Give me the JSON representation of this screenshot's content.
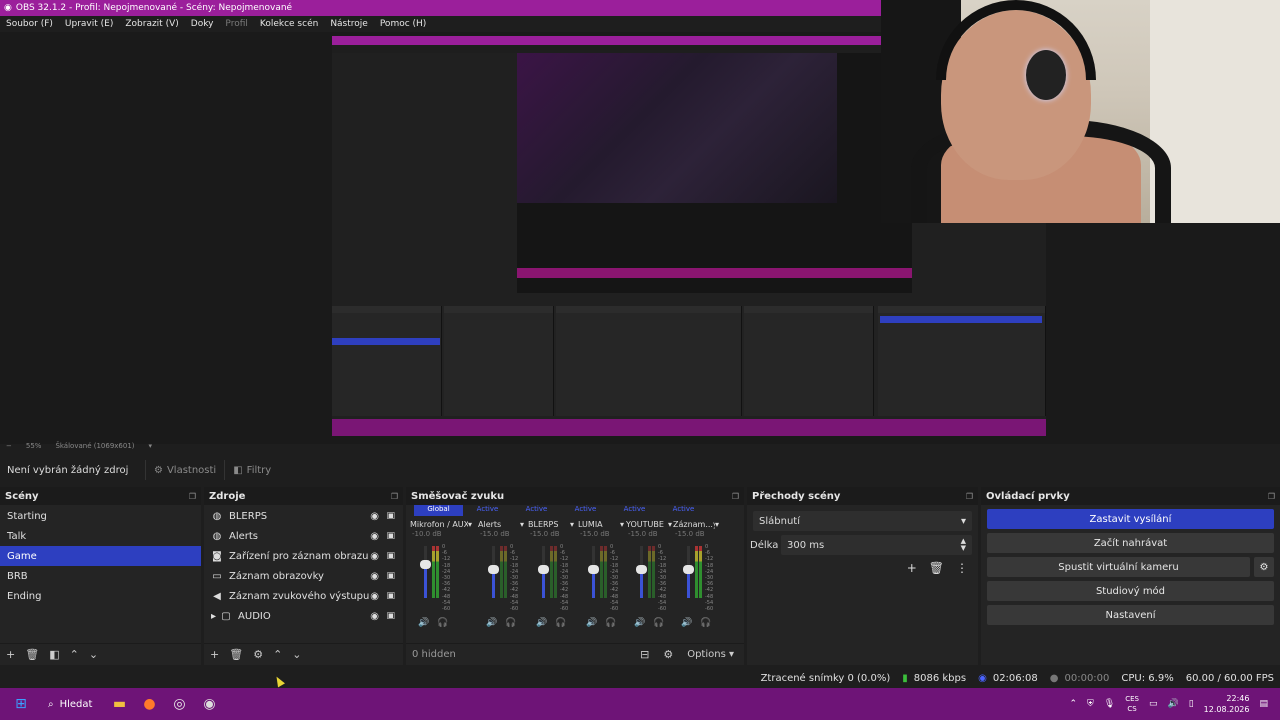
{
  "window": {
    "title": "OBS 32.1.2 - Profil: Nepojmenované - Scény: Nepojmenované"
  },
  "menu": [
    {
      "label": "Soubor (F)",
      "dim": false
    },
    {
      "label": "Upravit (E)",
      "dim": false
    },
    {
      "label": "Zobrazit (V)",
      "dim": false
    },
    {
      "label": "Doky",
      "dim": false
    },
    {
      "label": "Profil",
      "dim": true
    },
    {
      "label": "Kolekce scén",
      "dim": false
    },
    {
      "label": "Nástroje",
      "dim": false
    },
    {
      "label": "Pomoc (H)",
      "dim": false
    }
  ],
  "preview": {
    "zoom": "55%",
    "scale_mode": "Škálované (1069x601)"
  },
  "context": {
    "no_source": "Není vybrán žádný zdroj",
    "properties": "Vlastnosti",
    "filters": "Filtry"
  },
  "scenes": {
    "title": "Scény",
    "items": [
      "Starting",
      "Talk",
      "Game",
      "BRB",
      "Ending"
    ],
    "selected_index": 2
  },
  "sources": {
    "title": "Zdroje",
    "items": [
      {
        "label": "BLERPS",
        "icon": "globe-icon"
      },
      {
        "label": "Alerts",
        "icon": "globe-icon"
      },
      {
        "label": "Zařízení pro záznam obrazu",
        "icon": "camera-icon"
      },
      {
        "label": "Záznam obrazovky",
        "icon": "monitor-icon"
      },
      {
        "label": "Záznam zvukového výstupu",
        "icon": "speaker-icon"
      },
      {
        "label": "AUDIO",
        "icon": "folder-icon"
      }
    ]
  },
  "mixer": {
    "title": "Směšovač zvuku",
    "tabs": [
      "Global",
      "Active",
      "Active",
      "Active",
      "Active",
      "Active"
    ],
    "channels": [
      {
        "name": "Mikrofon / AUX",
        "db": "-10.0 dB",
        "level": 0.65,
        "hot": true
      },
      {
        "name": "Alerts",
        "db": "-15.0 dB",
        "level": 0.55,
        "hot": false
      },
      {
        "name": "BLERPS",
        "db": "-15.0 dB",
        "level": 0.55,
        "hot": false
      },
      {
        "name": "LUMIA",
        "db": "-15.0 dB",
        "level": 0.55,
        "hot": false
      },
      {
        "name": "YOUTUBE",
        "db": "-15.0 dB",
        "level": 0.55,
        "hot": false
      },
      {
        "name": "Záznam...ýstupu",
        "db": "-15.0 dB",
        "level": 0.55,
        "hot": true
      }
    ],
    "scale": [
      "0",
      "-6",
      "-12",
      "-18",
      "-24",
      "-30",
      "-36",
      "-42",
      "-48",
      "-54",
      "-60"
    ],
    "hidden": "0 hidden",
    "options": "Options"
  },
  "transitions": {
    "title": "Přechody scény",
    "selected": "Slábnutí",
    "duration_label": "Délka",
    "duration": "300 ms"
  },
  "controls": {
    "title": "Ovládací prvky",
    "stop_stream": "Zastavit vysílání",
    "start_record": "Začít nahrávat",
    "virtual_cam": "Spustit virtuální kameru",
    "studio_mode": "Studiový mód",
    "settings": "Nastavení"
  },
  "status": {
    "dropped": "Ztracené snímky 0 (0.0%)",
    "bitrate": "8086 kbps",
    "stream_time": "02:06:08",
    "record_time": "00:00:00",
    "cpu": "CPU: 6.9%",
    "fps": "60.00 / 60.00 FPS"
  },
  "taskbar": {
    "search": "Hledat",
    "lang_top": "CES",
    "lang_bottom": "CS",
    "time": "22:46",
    "date": "12.08.2026"
  },
  "colors": {
    "accent": "#2d3fc0",
    "titlebar": "#9b1f9b",
    "taskbar": "#6e1477"
  }
}
